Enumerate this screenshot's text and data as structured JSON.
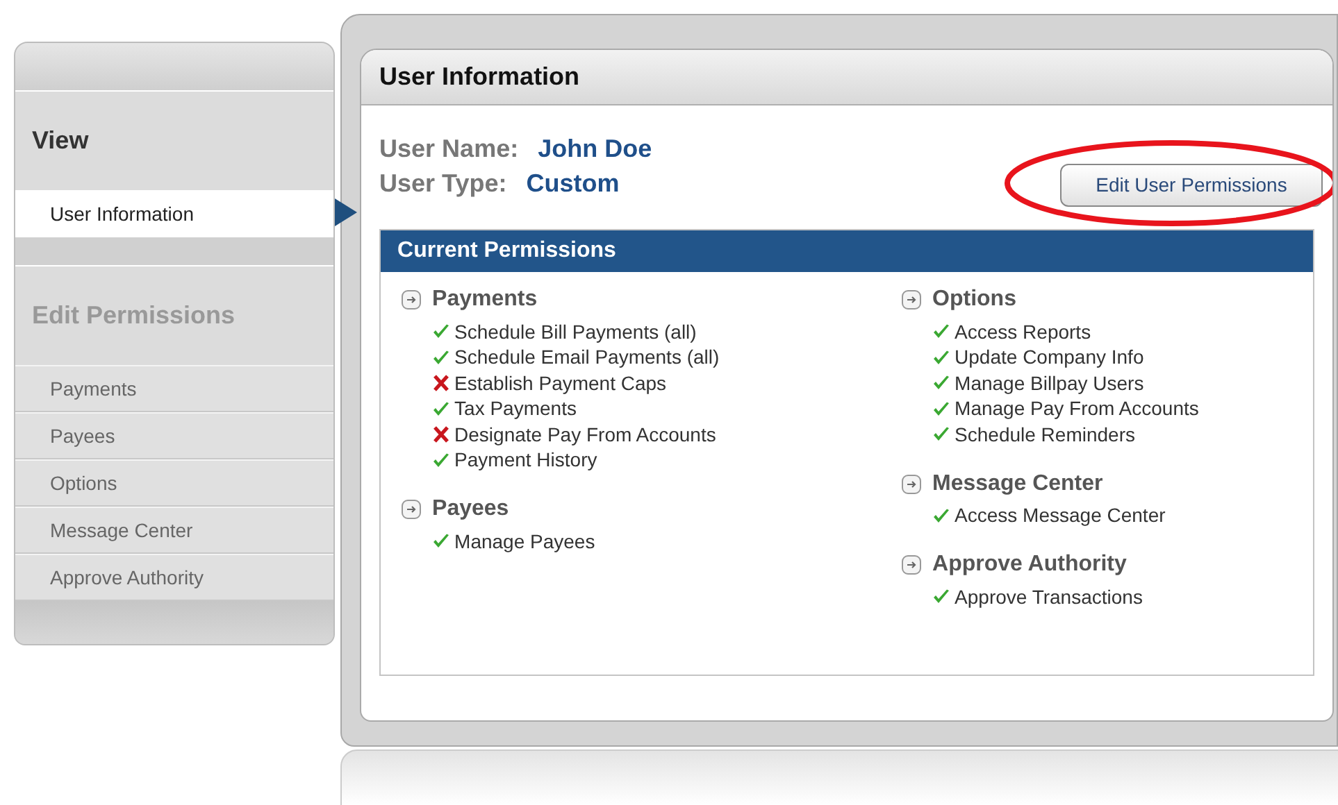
{
  "sidebar": {
    "sections": [
      {
        "heading": "View",
        "disabled": false,
        "items": [
          {
            "label": "User Information",
            "selected": true
          }
        ]
      },
      {
        "heading": "Edit Permissions",
        "disabled": true,
        "items": [
          {
            "label": "Payments",
            "selected": false
          },
          {
            "label": "Payees",
            "selected": false
          },
          {
            "label": "Options",
            "selected": false
          },
          {
            "label": "Message Center",
            "selected": false
          },
          {
            "label": "Approve Authority",
            "selected": false
          }
        ]
      }
    ]
  },
  "panel": {
    "title": "User Information",
    "fields": [
      {
        "label": "User Name:",
        "value": "John Doe"
      },
      {
        "label": "User Type:",
        "value": "Custom"
      }
    ],
    "edit_button": {
      "label": "Edit User Permissions",
      "highlighted": true
    },
    "permissions": {
      "title": "Current Permissions",
      "columns": [
        [
          {
            "name": "Payments",
            "items": [
              {
                "label": "Schedule Bill Payments (all)",
                "granted": true
              },
              {
                "label": "Schedule Email Payments (all)",
                "granted": true
              },
              {
                "label": "Establish Payment Caps",
                "granted": false
              },
              {
                "label": "Tax Payments",
                "granted": true
              },
              {
                "label": "Designate Pay From Accounts",
                "granted": false
              },
              {
                "label": "Payment History",
                "granted": true
              }
            ]
          },
          {
            "name": "Payees",
            "items": [
              {
                "label": "Manage Payees",
                "granted": true
              }
            ]
          }
        ],
        [
          {
            "name": "Options",
            "items": [
              {
                "label": "Access Reports",
                "granted": true
              },
              {
                "label": "Update Company Info",
                "granted": true
              },
              {
                "label": "Manage Billpay Users",
                "granted": true
              },
              {
                "label": "Manage Pay From Accounts",
                "granted": true
              },
              {
                "label": "Schedule Reminders",
                "granted": true
              }
            ]
          },
          {
            "name": "Message Center",
            "items": [
              {
                "label": "Access Message Center",
                "granted": true
              }
            ]
          },
          {
            "name": "Approve Authority",
            "items": [
              {
                "label": "Approve Transactions",
                "granted": true
              }
            ]
          }
        ]
      ]
    }
  }
}
